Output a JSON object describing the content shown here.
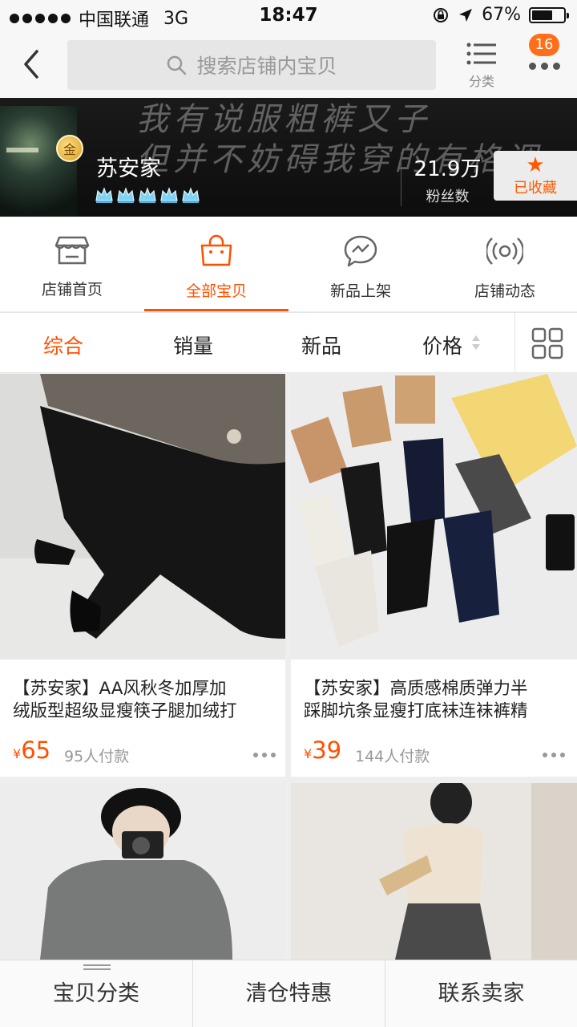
{
  "status_bar": {
    "carrier": "中国联通",
    "network": "3G",
    "time": "18:47",
    "battery_text": "67%",
    "battery_level": 0.67
  },
  "nav": {
    "search_placeholder": "搜索店铺内宝贝",
    "category_label": "分类",
    "message_badge": "16"
  },
  "shop": {
    "banner_text": "我有说服粗裤又子\n但并不妨碍我穿的有格调",
    "name": "苏安家",
    "gold_label": "金",
    "crown_count": 5,
    "fans_count": "21.9万",
    "fans_label": "粉丝数",
    "favorite_label": "已收藏"
  },
  "tabs": [
    {
      "label": "店铺首页",
      "icon": "store-icon",
      "active": false
    },
    {
      "label": "全部宝贝",
      "icon": "shopping-bag-icon",
      "active": true
    },
    {
      "label": "新品上架",
      "icon": "chat-bubble-icon",
      "active": false
    },
    {
      "label": "店铺动态",
      "icon": "broadcast-icon",
      "active": false
    }
  ],
  "sort": {
    "options": [
      "综合",
      "销量",
      "新品",
      "价格"
    ],
    "active": "综合"
  },
  "products": [
    {
      "title_line1": "【苏安家】AA风秋冬加厚加",
      "title_line2": "绒版型超级显瘦筷子腿加绒打",
      "currency": "¥",
      "price": "65",
      "sold": "95人付款"
    },
    {
      "title_line1": "【苏安家】高质感棉质弹力半",
      "title_line2": "踩脚坑条显瘦打底袜连袜裤精",
      "currency": "¥",
      "price": "39",
      "sold": "144人付款"
    },
    {
      "title_line1": "",
      "title_line2": "",
      "currency": "",
      "price": "",
      "sold": ""
    },
    {
      "title_line1": "",
      "title_line2": "",
      "currency": "",
      "price": "",
      "sold": ""
    }
  ],
  "bottom_bar": [
    "宝贝分类",
    "清仓特惠",
    "联系卖家"
  ],
  "colors": {
    "accent": "#ff5000",
    "badge": "#ff6f1a",
    "banner_bg": "#111111"
  }
}
